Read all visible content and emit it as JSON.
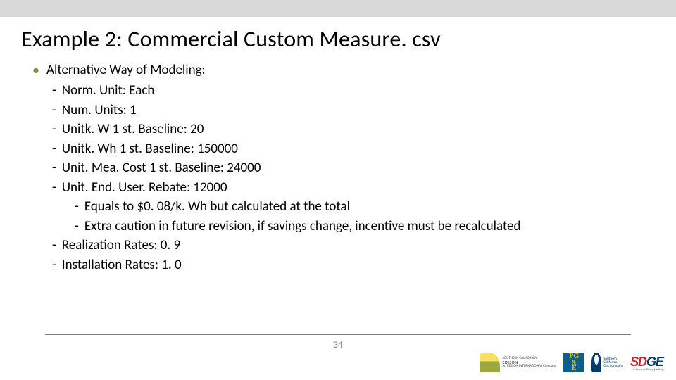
{
  "title": "Example 2: Commercial Custom Measure. csv",
  "bullet_heading": "Alternative Way of Modeling:",
  "items": [
    "Norm. Unit: Each",
    "Num. Units: 1",
    "Unitk. W 1 st. Baseline: 20",
    "Unitk. Wh 1 st. Baseline: 150000",
    "Unit. Mea. Cost 1 st. Baseline: 24000",
    "Unit. End. User. Rebate: 12000"
  ],
  "subitems": [
    "Equals to $0. 08/k. Wh but calculated at the total",
    "Extra caution in future revision, if savings change, incentive must be recalculated"
  ],
  "items_after": [
    "Realization Rates: 0. 9",
    "Installation Rates: 1. 0"
  ],
  "page_number": "34",
  "logos": {
    "edison_line1": "SOUTHERN CALIFORNIA",
    "edison_line2": "EDISON",
    "edison_line3": "An EDISON INTERNATIONAL Company",
    "pge_top": "PG",
    "pge_mid": "&",
    "pge_bot": "E",
    "flame_line1": "Southern",
    "flame_line2": "California",
    "flame_line3": "Gas Company",
    "sdge_main_red": "SD",
    "sdge_main_blue": "GE",
    "sdge_sub": "A Sempra Energy utility"
  }
}
